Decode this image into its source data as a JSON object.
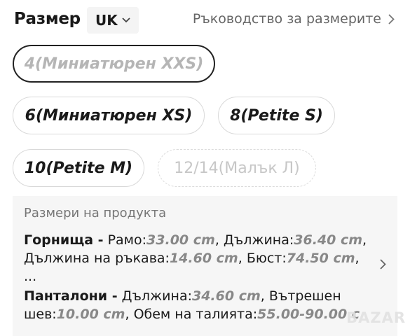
{
  "header": {
    "title": "Размер",
    "region": "UK",
    "size_guide": "Ръководство за размерите"
  },
  "sizes": [
    {
      "label": "4(Миниатюрен XXS)",
      "state": "selected"
    },
    {
      "label": "6(Миниатюрен XS)",
      "state": "available"
    },
    {
      "label": "8(Petite S)",
      "state": "available"
    },
    {
      "label": "10(Petite M)",
      "state": "available"
    },
    {
      "label": "12/14(Малък Л)",
      "state": "unavailable"
    }
  ],
  "product_sizes": {
    "title": "Размери на продукта",
    "top": {
      "label": "Горнища -",
      "shoulder_label": "Рамо:",
      "shoulder": "33.00 cm",
      "length_label": "Дължина:",
      "length": "36.40 cm",
      "sleeve_label": "Дължина на ръкава:",
      "sleeve": "14.60 cm",
      "bust_label": "Бюст:",
      "bust": "74.50 cm",
      "ellipsis": "..."
    },
    "pants": {
      "label": "Панталони -",
      "length_label": "Дължина:",
      "length": "34.60 cm",
      "inseam_label": "Вътрешен шев:",
      "inseam": "10.00 cm",
      "waist_label": "Обем на талията:",
      "waist": "55.00-90.00 c"
    }
  },
  "watermark": "BAZAR",
  "colors": {
    "selected_border": "#222222",
    "muted_text": "#888888",
    "panel_bg": "#f6f6f6"
  }
}
